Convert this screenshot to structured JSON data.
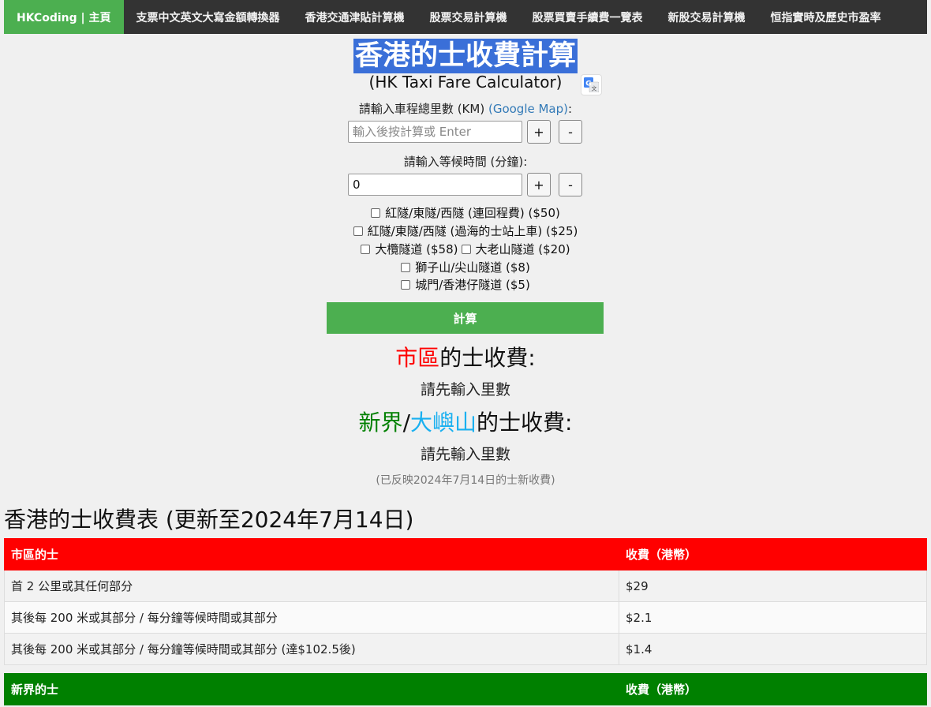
{
  "nav": {
    "items": [
      {
        "label": "HKCoding | 主頁",
        "active": true
      },
      {
        "label": "支票中文英文大寫金額轉換器"
      },
      {
        "label": "香港交通津貼計算機"
      },
      {
        "label": "股票交易計算機"
      },
      {
        "label": "股票買賣手續費一覽表"
      },
      {
        "label": "新股交易計算機"
      },
      {
        "label": "恒指實時及歷史市盈率"
      }
    ]
  },
  "calculator": {
    "title": "香港的士收費計算",
    "subtitle": "(HK Taxi Fare Calculator)",
    "distance_label": "請輸入車程總里數 (KM)",
    "google_map_link": "(Google Map)",
    "colon": ":",
    "distance_input": {
      "value": "",
      "placeholder": "輸入後按計算或 Enter"
    },
    "waiting_label": "請輸入等候時間 (分鐘):",
    "waiting_input": {
      "value": "0",
      "placeholder": ""
    },
    "plus": "+",
    "minus": "-",
    "tunnels": {
      "cross_harbour_return": "紅隧/東隧/西隧 (連回程費) ($50)",
      "cross_harbour_stand": "紅隧/東隧/西隧 (過海的士站上車) ($25)",
      "tai_lam": "大欖隧道 ($58)",
      "tai_lo_shan": "大老山隧道 ($20)",
      "lion_rock": "獅子山/尖山隧道 ($8)",
      "shing_mun": "城門/香港仔隧道 ($5)"
    },
    "calculate_button": "計算"
  },
  "results": {
    "urban_head": {
      "part1": "市區",
      "part2": "的士收費:"
    },
    "urban_text": "請先輸入里數",
    "nt_head": {
      "part1": "新界",
      "slash": "/",
      "part2": "大嶼山",
      "part3": "的士收費:"
    },
    "nt_text": "請先輸入里數",
    "note": "(已反映2024年7月14日的士新收費)"
  },
  "fare_table": {
    "title": "香港的士收費表 (更新至2024年7月14日)",
    "urban": {
      "headers": [
        "市區的士",
        "收費（港幣）"
      ],
      "rows": [
        [
          "首 2 公里或其任何部分",
          "$29"
        ],
        [
          "其後每 200 米或其部分 / 每分鐘等候時間或其部分",
          "$2.1"
        ],
        [
          "其後每 200 米或其部分 / 每分鐘等候時間或其部分 (達$102.5後)",
          "$1.4"
        ]
      ]
    },
    "nt": {
      "headers": [
        "新界的士",
        "收費（港幣）"
      ]
    }
  },
  "colors": {
    "nav_bg": "#333333",
    "nav_active": "#4caf50",
    "calc_button": "#4caf50",
    "urban_red": "#ff0000",
    "nt_green": "#008000",
    "lantau_blue": "#1ab0f0",
    "title_highlight": "#3a6fd8"
  },
  "icons": {
    "translate": "google-translate-icon"
  }
}
